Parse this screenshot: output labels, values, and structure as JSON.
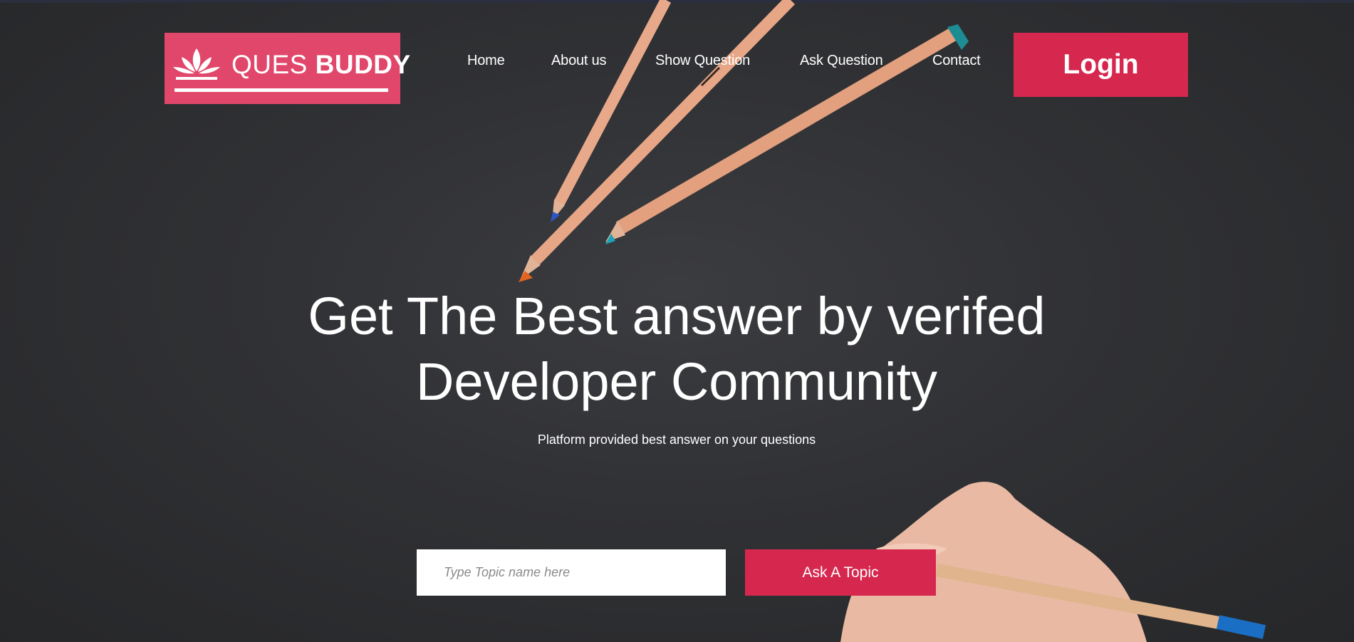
{
  "logo": {
    "text_light": "QUES",
    "text_bold": "BUDDY",
    "icon": "lotus-icon"
  },
  "nav": {
    "items": [
      {
        "label": "Home"
      },
      {
        "label": "About us"
      },
      {
        "label": "Show Question"
      },
      {
        "label": "Ask Question"
      },
      {
        "label": "Contact"
      }
    ],
    "login_label": "Login"
  },
  "hero": {
    "headline_line1": "Get The Best answer by verifed",
    "headline_line2": "Developer Community",
    "subline": "Platform provided best answer on your questions",
    "input_placeholder": "Type Topic name here",
    "ask_button_label": "Ask A Topic"
  },
  "colors": {
    "brand": "#d6284f",
    "logo_bg": "#e0476a",
    "background": "#2f3033"
  }
}
